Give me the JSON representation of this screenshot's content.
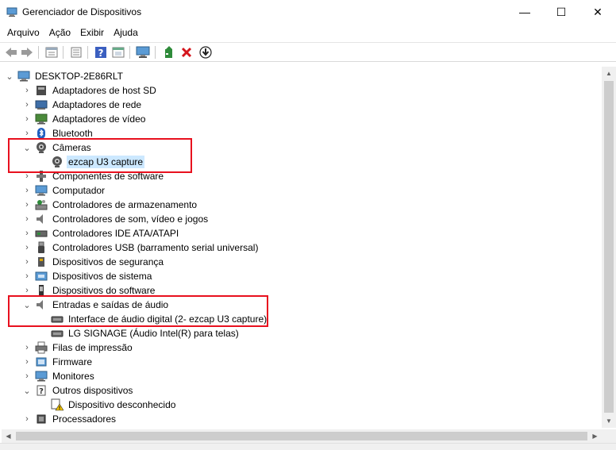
{
  "window": {
    "title": "Gerenciador de Dispositivos",
    "min_glyph": "—",
    "max_glyph": "☐",
    "close_glyph": "✕"
  },
  "menu": [
    "Arquivo",
    "Ação",
    "Exibir",
    "Ajuda"
  ],
  "toolbar": {
    "back": "back-arrow-icon",
    "forward": "forward-arrow-icon",
    "properties": "properties-icon",
    "update": "update-driver-icon",
    "help": "help-icon",
    "view": "view-icon",
    "monitor": "scan-hardware-icon",
    "add": "add-driver-icon",
    "remove": "uninstall-icon",
    "download": "download-icon"
  },
  "tree": {
    "root": "DESKTOP-2E86RLT",
    "items": [
      {
        "label": "Adaptadores de host SD",
        "icon": "sd-host-icon"
      },
      {
        "label": "Adaptadores de rede",
        "icon": "network-adapter-icon"
      },
      {
        "label": "Adaptadores de vídeo",
        "icon": "display-adapter-icon"
      },
      {
        "label": "Bluetooth",
        "icon": "bluetooth-icon"
      },
      {
        "label": "Câmeras",
        "icon": "camera-icon",
        "expanded": true,
        "children": [
          {
            "label": "ezcap U3 capture",
            "icon": "camera-icon",
            "selected": true
          }
        ]
      },
      {
        "label": "Componentes de software",
        "icon": "software-component-icon"
      },
      {
        "label": "Computador",
        "icon": "computer-icon"
      },
      {
        "label": "Controladores de armazenamento",
        "icon": "storage-controller-icon"
      },
      {
        "label": "Controladores de som, vídeo e jogos",
        "icon": "sound-icon"
      },
      {
        "label": "Controladores IDE ATA/ATAPI",
        "icon": "ide-controller-icon"
      },
      {
        "label": "Controladores USB (barramento serial universal)",
        "icon": "usb-icon"
      },
      {
        "label": "Dispositivos de segurança",
        "icon": "security-device-icon"
      },
      {
        "label": "Dispositivos de sistema",
        "icon": "system-device-icon"
      },
      {
        "label": "Dispositivos do software",
        "icon": "software-device-icon"
      },
      {
        "label": "Entradas e saídas de áudio",
        "icon": "audio-io-icon",
        "expanded": true,
        "children": [
          {
            "label": "Interface de áudio digital (2- ezcap U3 capture)",
            "icon": "audio-interface-icon"
          },
          {
            "label": "LG SIGNAGE (Áudio Intel(R) para telas)",
            "icon": "audio-interface-icon"
          }
        ]
      },
      {
        "label": "Filas de impressão",
        "icon": "print-queue-icon"
      },
      {
        "label": "Firmware",
        "icon": "firmware-icon"
      },
      {
        "label": "Monitores",
        "icon": "monitor-icon"
      },
      {
        "label": "Outros dispositivos",
        "icon": "other-devices-icon",
        "expanded": true,
        "children": [
          {
            "label": "Dispositivo desconhecido",
            "icon": "unknown-device-warning-icon"
          }
        ]
      },
      {
        "label": "Processadores",
        "icon": "processor-icon"
      }
    ]
  },
  "colors": {
    "highlight_border": "#e8101e",
    "selection_bg": "#cce8ff"
  }
}
